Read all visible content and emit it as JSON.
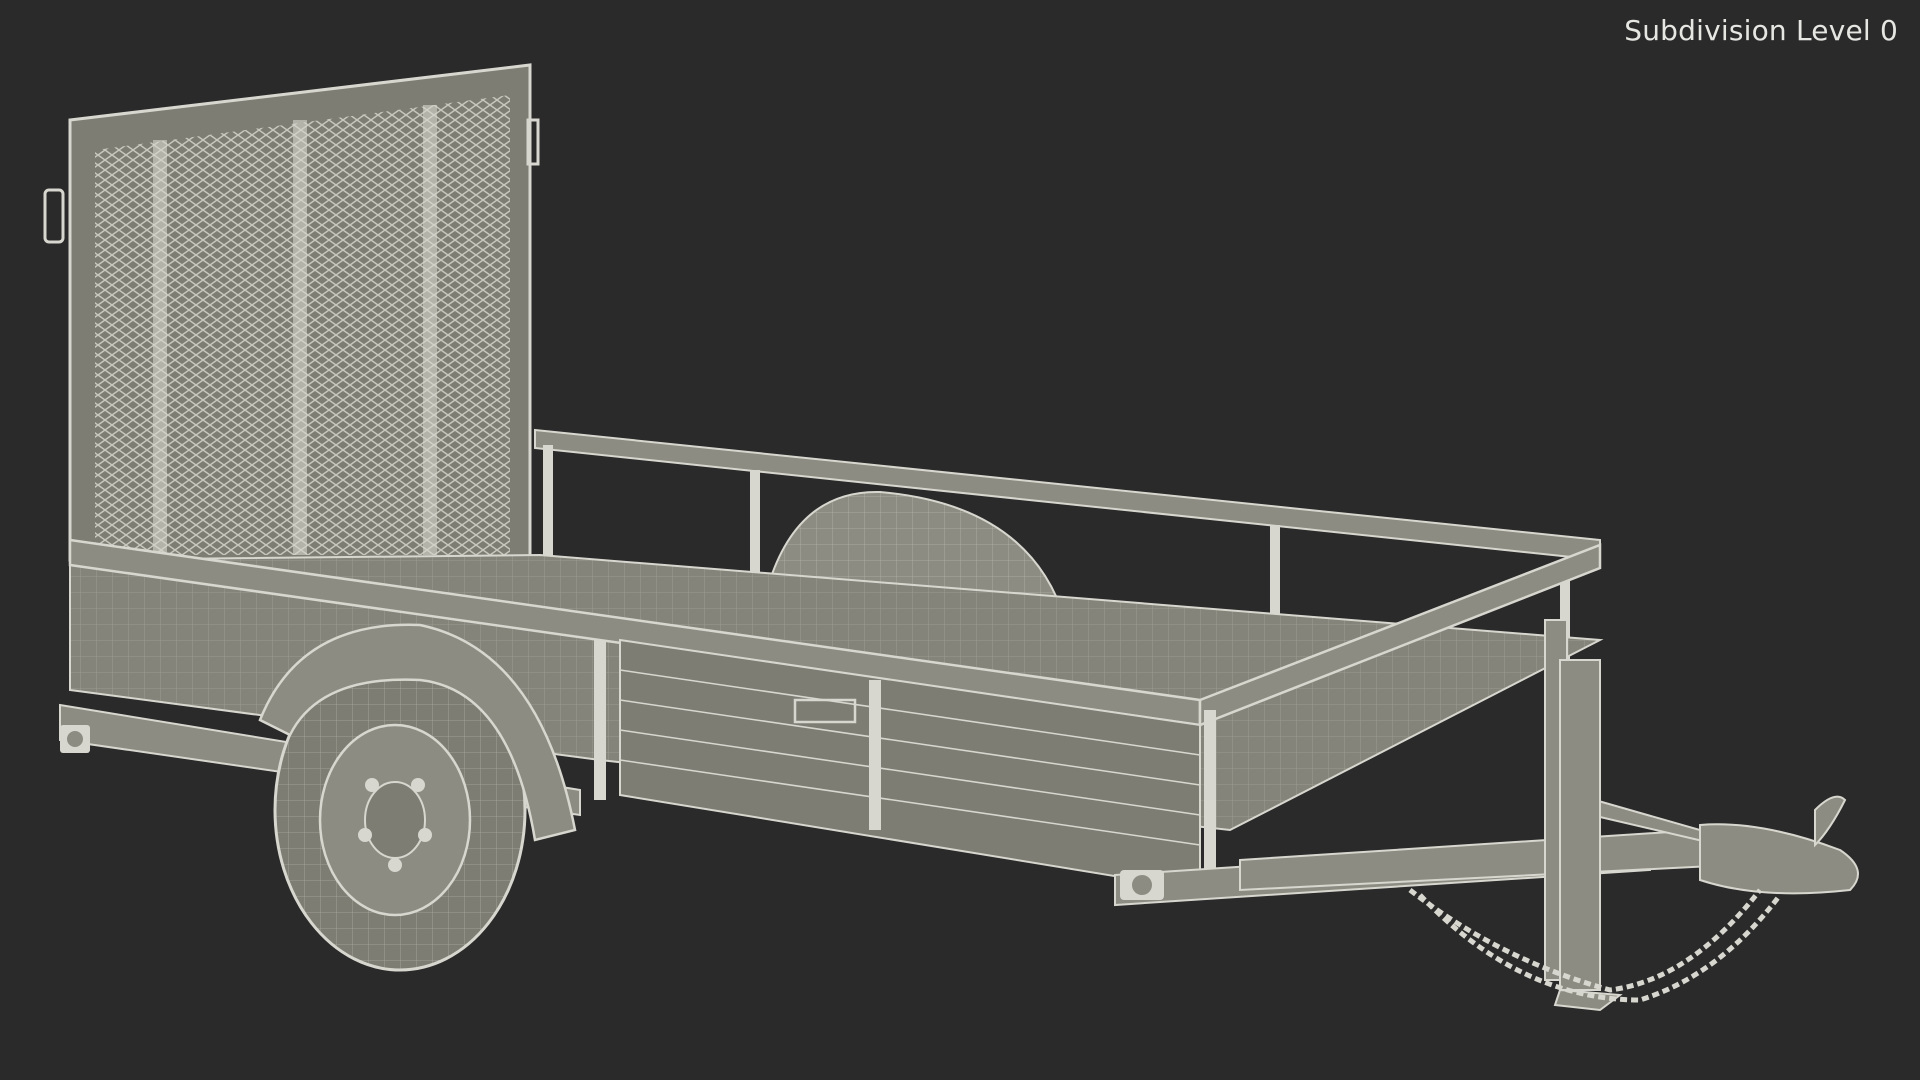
{
  "viewport": {
    "overlay_label": "Subdivision Level 0",
    "background_color": "#2a2a2a"
  },
  "model": {
    "subject": "utility trailer wireframe",
    "fill_color": "#8d8c82",
    "wire_color": "#d8d7cf"
  }
}
